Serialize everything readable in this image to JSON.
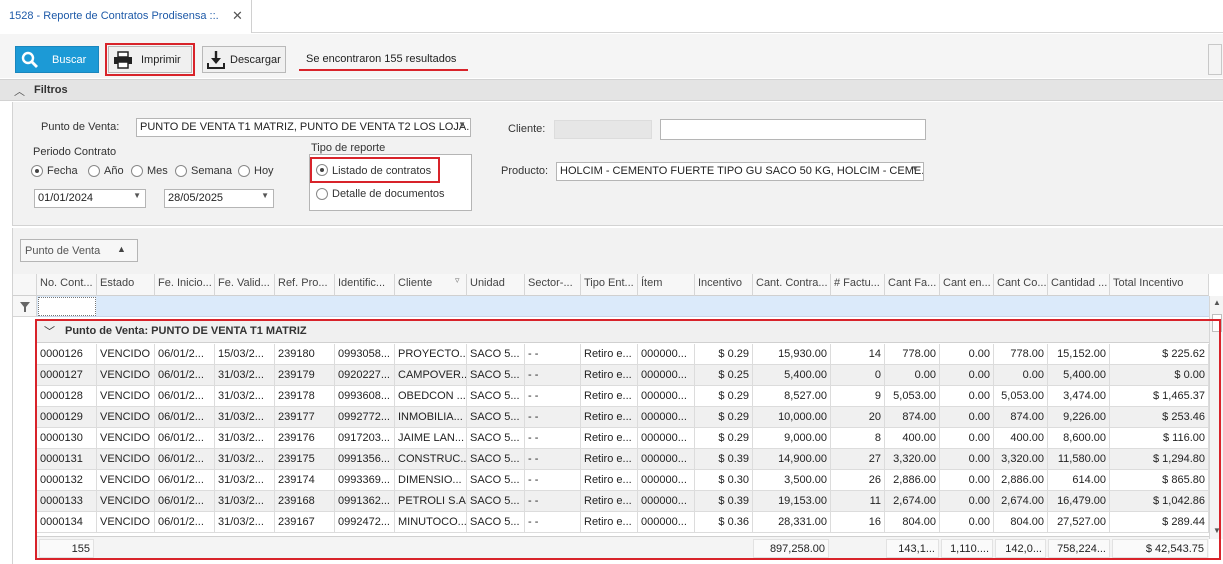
{
  "tab": {
    "title": "1528 - Reporte de Contratos Prodisensa ::.",
    "close": "✕"
  },
  "toolbar": {
    "search_label": "Buscar",
    "print_label": "Imprimir",
    "download_label": "Descargar",
    "results_text": "Se encontraron 155 resultados"
  },
  "filters": {
    "title": "Filtros",
    "punto_label": "Punto de Venta:",
    "punto_value": "PUNTO DE VENTA T1 MATRIZ, PUNTO DE VENTA T2  LOS LOJA...",
    "periodo_label": "Periodo Contrato",
    "periodo_options": [
      "Fecha",
      "Año",
      "Mes",
      "Semana",
      "Hoy"
    ],
    "date_from": "01/01/2024",
    "date_to": "28/05/2025",
    "tipo_label": "Tipo de reporte",
    "tipo_options": [
      "Listado de contratos",
      "Detalle de documentos"
    ],
    "cliente_label": "Cliente:",
    "producto_label": "Producto:",
    "producto_value": "HOLCIM  - CEMENTO FUERTE TIPO GU SACO 50 KG, HOLCIM  - CEME..."
  },
  "grid": {
    "group_chip": "Punto de Venta",
    "columns": [
      "No. Cont...",
      "Estado",
      "Fe. Inicio...",
      "Fe. Valid...",
      "Ref. Pro...",
      "Identific...",
      "Cliente",
      "Unidad",
      "Sector-...",
      "Tipo Ent...",
      "Ítem",
      "Incentivo",
      "Cant. Contra...",
      "# Factu...",
      "Cant Fa...",
      "Cant en...",
      "Cant Co...",
      "Cantidad ...",
      "Total Incentivo"
    ],
    "group_row": "Punto de Venta: PUNTO DE VENTA T1 MATRIZ",
    "rows": [
      [
        "0000126",
        "VENCIDO",
        "06/01/2...",
        "15/03/2...",
        "239180",
        "0993058...",
        "PROYECTO...",
        "SACO 5...",
        "- -",
        "Retiro e...",
        "000000...",
        "$ 0.29",
        "15,930.00",
        "14",
        "778.00",
        "0.00",
        "778.00",
        "15,152.00",
        "$ 225.62"
      ],
      [
        "0000127",
        "VENCIDO",
        "06/01/2...",
        "31/03/2...",
        "239179",
        "0920227...",
        "CAMPOVER...",
        "SACO 5...",
        "- -",
        "Retiro e...",
        "000000...",
        "$ 0.25",
        "5,400.00",
        "0",
        "0.00",
        "0.00",
        "0.00",
        "5,400.00",
        "$ 0.00"
      ],
      [
        "0000128",
        "VENCIDO",
        "06/01/2...",
        "31/03/2...",
        "239178",
        "0993608...",
        "OBEDCON ...",
        "SACO 5...",
        "- -",
        "Retiro e...",
        "000000...",
        "$ 0.29",
        "8,527.00",
        "9",
        "5,053.00",
        "0.00",
        "5,053.00",
        "3,474.00",
        "$ 1,465.37"
      ],
      [
        "0000129",
        "VENCIDO",
        "06/01/2...",
        "31/03/2...",
        "239177",
        "0992772...",
        "INMOBILIA...",
        "SACO 5...",
        "- -",
        "Retiro e...",
        "000000...",
        "$ 0.29",
        "10,000.00",
        "20",
        "874.00",
        "0.00",
        "874.00",
        "9,226.00",
        "$ 253.46"
      ],
      [
        "0000130",
        "VENCIDO",
        "06/01/2...",
        "31/03/2...",
        "239176",
        "0917203...",
        "JAIME LAN...",
        "SACO 5...",
        "- -",
        "Retiro e...",
        "000000...",
        "$ 0.29",
        "9,000.00",
        "8",
        "400.00",
        "0.00",
        "400.00",
        "8,600.00",
        "$ 116.00"
      ],
      [
        "0000131",
        "VENCIDO",
        "06/01/2...",
        "31/03/2...",
        "239175",
        "0991356...",
        "CONSTRUC...",
        "SACO 5...",
        "- -",
        "Retiro e...",
        "000000...",
        "$ 0.39",
        "14,900.00",
        "27",
        "3,320.00",
        "0.00",
        "3,320.00",
        "11,580.00",
        "$ 1,294.80"
      ],
      [
        "0000132",
        "VENCIDO",
        "06/01/2...",
        "31/03/2...",
        "239174",
        "0993369...",
        "DIMENSIO...",
        "SACO 5...",
        "- -",
        "Retiro e...",
        "000000...",
        "$ 0.30",
        "3,500.00",
        "26",
        "2,886.00",
        "0.00",
        "2,886.00",
        "614.00",
        "$ 865.80"
      ],
      [
        "0000133",
        "VENCIDO",
        "06/01/2...",
        "31/03/2...",
        "239168",
        "0991362...",
        "PETROLI S.A",
        "SACO 5...",
        "- -",
        "Retiro e...",
        "000000...",
        "$ 0.39",
        "19,153.00",
        "11",
        "2,674.00",
        "0.00",
        "2,674.00",
        "16,479.00",
        "$ 1,042.86"
      ],
      [
        "0000134",
        "VENCIDO",
        "06/01/2...",
        "31/03/2...",
        "239167",
        "0992472...",
        "MINUTOCO...",
        "SACO 5...",
        "- -",
        "Retiro e...",
        "000000...",
        "$ 0.36",
        "28,331.00",
        "16",
        "804.00",
        "0.00",
        "804.00",
        "27,527.00",
        "$ 289.44"
      ]
    ],
    "footer": {
      "count": "155",
      "cant_contra": "897,258.00",
      "cant_fa": "143,1...",
      "cant_en": "1,110....",
      "cant_co": "142,0...",
      "cantidad": "758,224...",
      "total_incentivo": "$ 42,543.75"
    }
  },
  "colors": {
    "accent": "#1c9ad6",
    "highlight": "#d8232a",
    "tab_text": "#1e5aa8"
  }
}
